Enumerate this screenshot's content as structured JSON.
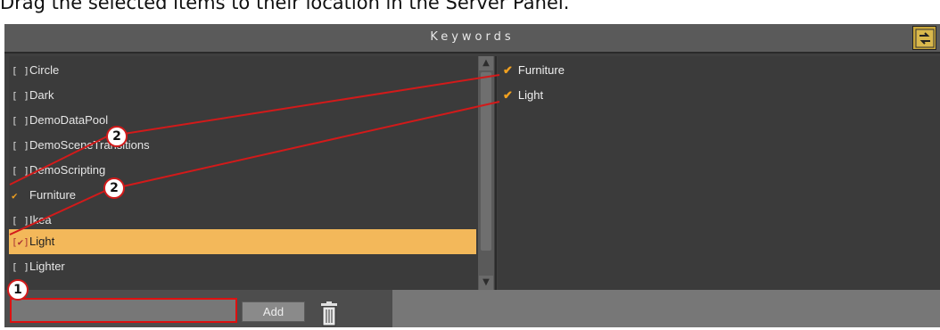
{
  "caption": "Drag the selected items to their location in the Server Panel.",
  "header": {
    "title": "Keywords",
    "tool_icon": "swap-icon"
  },
  "left_list": {
    "items": [
      {
        "label": "Circle",
        "checked": false,
        "box": "[ ]"
      },
      {
        "label": "Dark",
        "checked": false,
        "box": "[ ]"
      },
      {
        "label": "DemoDataPool",
        "checked": false,
        "box": "[ ]"
      },
      {
        "label": "DemoSceneTransitions",
        "checked": false,
        "box": "[ ]"
      },
      {
        "label": "DemoScripting",
        "checked": false,
        "box": "[ ]"
      },
      {
        "label": "Furniture",
        "checked": true,
        "box": "✔"
      },
      {
        "label": "Ikea",
        "checked": false,
        "box": "[ ]"
      },
      {
        "label": "Light",
        "checked": true,
        "box": "[✔]",
        "selected": true
      },
      {
        "label": "Lighter",
        "checked": false,
        "box": "[ ]"
      }
    ]
  },
  "right_list": {
    "items": [
      {
        "label": "Furniture",
        "checked": true,
        "box": "✔"
      },
      {
        "label": "Light",
        "checked": true,
        "box": "✔"
      }
    ]
  },
  "footer": {
    "input_value": "",
    "add_label": "Add",
    "trash_icon": "trash-icon"
  },
  "callouts": {
    "one": "1",
    "two_a": "2",
    "two_b": "2"
  },
  "colors": {
    "highlight": "#f3b85a",
    "callout_red": "#d21a1a",
    "check": "#f0a020"
  }
}
